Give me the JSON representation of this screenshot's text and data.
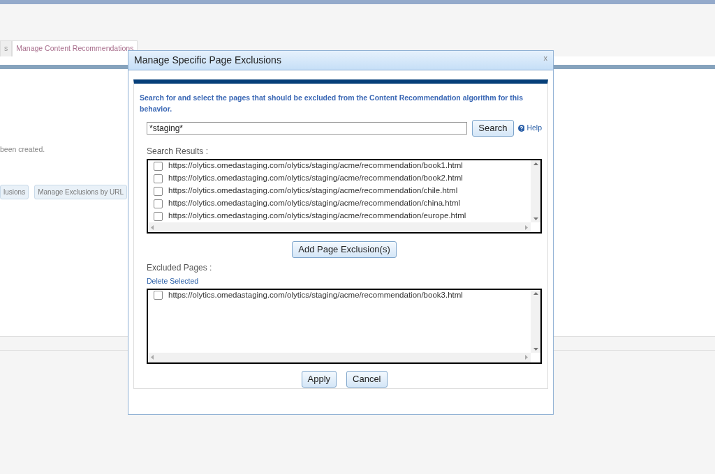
{
  "page": {
    "tabs": [
      {
        "label": "s",
        "selected": false
      },
      {
        "label": "Manage Content Recommendations",
        "selected": true
      }
    ],
    "message": "been created.",
    "buttons": [
      "lusions",
      "Manage Exclusions by URL"
    ]
  },
  "dialog": {
    "title": "Manage Specific Page Exclusions",
    "close": "x",
    "instructions": "Search for and select the pages that should be excluded from the Content Recommendation algorithm for this behavior.",
    "search": {
      "value": "*staging*",
      "button": "Search",
      "help": "Help"
    },
    "results_label": "Search Results :",
    "results": [
      {
        "url": "https://olytics.omedastaging.com/olytics/staging/acme/recommendation/book1.html",
        "checked": false
      },
      {
        "url": "https://olytics.omedastaging.com/olytics/staging/acme/recommendation/book2.html",
        "checked": false
      },
      {
        "url": "https://olytics.omedastaging.com/olytics/staging/acme/recommendation/chile.html",
        "checked": false
      },
      {
        "url": "https://olytics.omedastaging.com/olytics/staging/acme/recommendation/china.html",
        "checked": false
      },
      {
        "url": "https://olytics.omedastaging.com/olytics/staging/acme/recommendation/europe.html",
        "checked": false
      }
    ],
    "add_button": "Add Page Exclusion(s)",
    "excluded_label": "Excluded Pages :",
    "delete_link": "Delete Selected",
    "excluded": [
      {
        "url": "https://olytics.omedastaging.com/olytics/staging/acme/recommendation/book3.html",
        "checked": false
      }
    ],
    "buttons": [
      "Apply",
      "Cancel"
    ]
  }
}
